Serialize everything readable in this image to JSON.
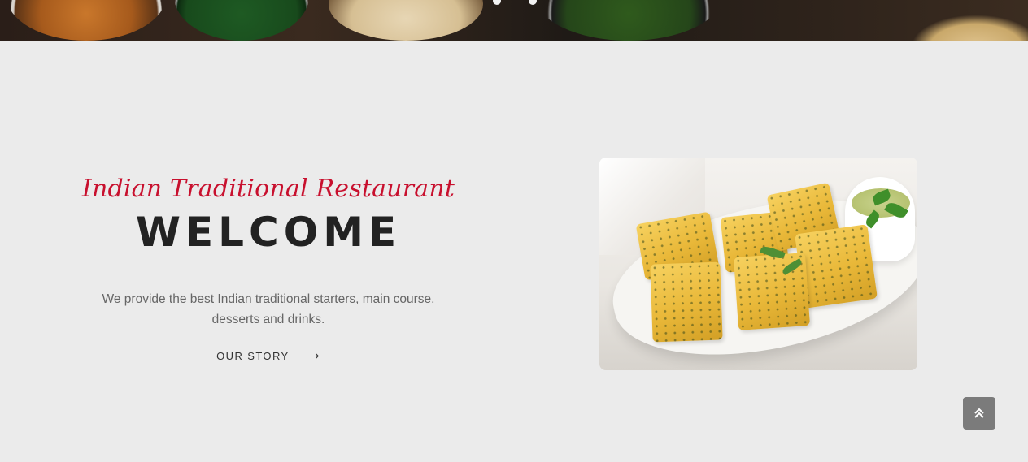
{
  "hero": {
    "subtitle": "Indian Traditional Restaurant",
    "title": "WELCOME",
    "description_line1": "We provide the best Indian traditional starters, main course,",
    "description_line2": "desserts and drinks.",
    "cta_label": "OUR STORY",
    "cta_icon": "arrow-right-icon"
  },
  "colors": {
    "accent": "#c8102e",
    "heading": "#222222",
    "body_text": "#666666",
    "background": "#ebebeb",
    "scroll_button": "#7b7b7b"
  },
  "image": {
    "subject": "food-photo-dhokla"
  },
  "scroll_top": {
    "icon": "double-chevron-up-icon"
  }
}
